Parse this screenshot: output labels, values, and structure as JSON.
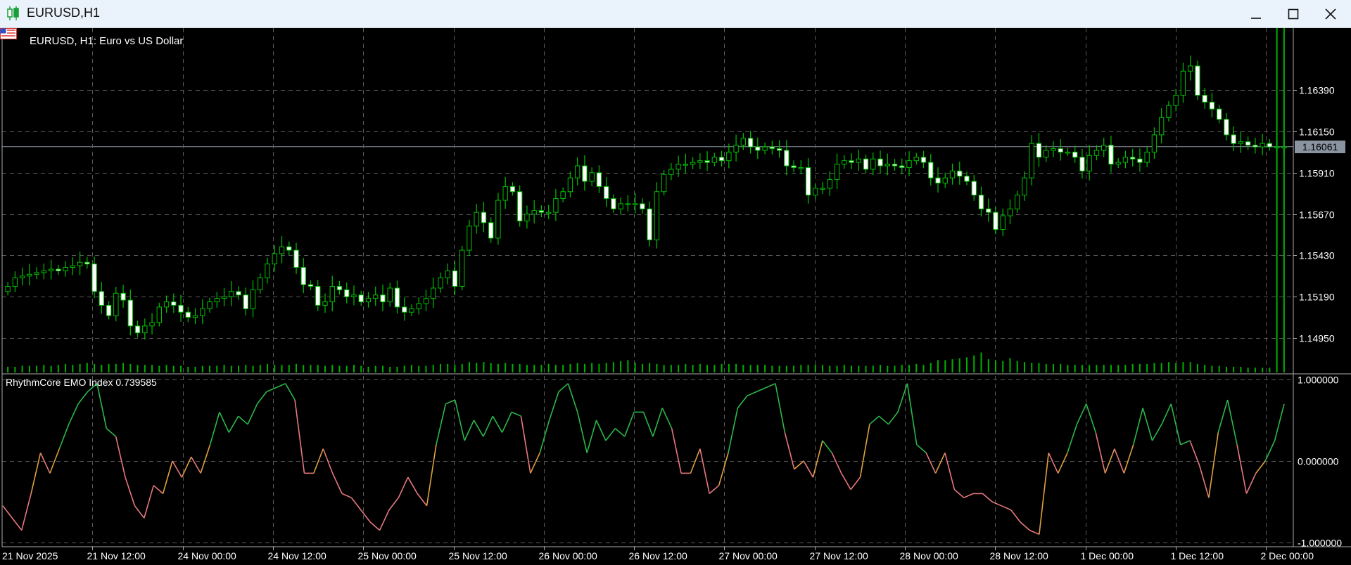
{
  "window": {
    "title": "EURUSD,H1",
    "icon": "candlestick-icon",
    "buttons": {
      "minimize": "minimize-icon",
      "maximize": "maximize-icon",
      "close": "close-icon"
    }
  },
  "chart_data": [
    {
      "type": "candlestick",
      "title": "EURUSD, H1:  Euro vs US Dollar",
      "symbol_icon": "flag-icon",
      "ylim": [
        1.1475,
        1.1675
      ],
      "y_ticks": [
        "1.16390",
        "1.16150",
        "1.15910",
        "1.15670",
        "1.15430",
        "1.15190",
        "1.14950"
      ],
      "current_price": "1.16061",
      "x_labels": [
        "21 Nov 2025",
        "21 Nov 12:00",
        "24 Nov 00:00",
        "24 Nov 12:00",
        "25 Nov 00:00",
        "25 Nov 12:00",
        "26 Nov 00:00",
        "26 Nov 12:00",
        "27 Nov 00:00",
        "27 Nov 12:00",
        "28 Nov 00:00",
        "28 Nov 12:00",
        "1 Dec 00:00",
        "1 Dec 12:00",
        "2 Dec 00:00"
      ],
      "grid": true,
      "colors": {
        "up_body": "#000000",
        "down_body": "#ffffff",
        "wick": "#00c000",
        "grid": "#5a5a5a",
        "volume": "#00b000",
        "axis_text": "#ffffff"
      },
      "closes": [
        1.1525,
        1.153,
        1.1531,
        1.1532,
        1.1533,
        1.1534,
        1.1535,
        1.1534,
        1.1536,
        1.1537,
        1.1539,
        1.1538,
        1.1522,
        1.1514,
        1.1508,
        1.1521,
        1.1517,
        1.1502,
        1.1498,
        1.1502,
        1.1504,
        1.1513,
        1.1516,
        1.1514,
        1.151,
        1.1507,
        1.1508,
        1.1512,
        1.1516,
        1.1518,
        1.1519,
        1.1522,
        1.152,
        1.1512,
        1.1523,
        1.153,
        1.1538,
        1.1544,
        1.1548,
        1.1546,
        1.1536,
        1.1526,
        1.1525,
        1.1514,
        1.1516,
        1.1525,
        1.1523,
        1.1519,
        1.152,
        1.1516,
        1.1518,
        1.152,
        1.1516,
        1.1524,
        1.1513,
        1.151,
        1.1512,
        1.1515,
        1.1518,
        1.1524,
        1.153,
        1.1534,
        1.1525,
        1.1546,
        1.156,
        1.1568,
        1.1562,
        1.1553,
        1.1575,
        1.1583,
        1.158,
        1.1563,
        1.1567,
        1.1569,
        1.1568,
        1.1568,
        1.1576,
        1.158,
        1.1588,
        1.1595,
        1.1586,
        1.1591,
        1.1583,
        1.1576,
        1.157,
        1.1573,
        1.1573,
        1.1573,
        1.157,
        1.1552,
        1.158,
        1.159,
        1.1593,
        1.1596,
        1.1596,
        1.1597,
        1.1598,
        1.1597,
        1.16,
        1.1598,
        1.1603,
        1.1607,
        1.1611,
        1.1606,
        1.1604,
        1.1606,
        1.1605,
        1.1604,
        1.1595,
        1.1594,
        1.1594,
        1.1578,
        1.1582,
        1.1582,
        1.1587,
        1.1596,
        1.1598,
        1.1597,
        1.1599,
        1.1593,
        1.1599,
        1.1595,
        1.1596,
        1.1595,
        1.1594,
        1.1598,
        1.16,
        1.1597,
        1.1588,
        1.1585,
        1.1588,
        1.1592,
        1.1589,
        1.1586,
        1.1578,
        1.157,
        1.1568,
        1.1558,
        1.1566,
        1.157,
        1.1578,
        1.1588,
        1.1608,
        1.16,
        1.1604,
        1.1605,
        1.1603,
        1.1603,
        1.16,
        1.1592,
        1.1601,
        1.1604,
        1.1607,
        1.1596,
        1.1597,
        1.16,
        1.1599,
        1.1597,
        1.1603,
        1.1613,
        1.1623,
        1.163,
        1.1636,
        1.165,
        1.1653,
        1.1636,
        1.1632,
        1.1628,
        1.1622,
        1.1613,
        1.1608,
        1.1609,
        1.1607,
        1.1606,
        1.1608,
        1.1606,
        1.1606,
        1.1606
      ],
      "volumes": [
        6,
        6,
        7,
        7,
        7,
        8,
        7,
        8,
        9,
        8,
        9,
        10,
        9,
        8,
        9,
        9,
        10,
        9,
        8,
        8,
        8,
        7,
        8,
        7,
        7,
        6,
        6,
        7,
        7,
        7,
        8,
        7,
        7,
        8,
        7,
        8,
        9,
        8,
        8,
        8,
        9,
        8,
        8,
        8,
        7,
        8,
        7,
        7,
        8,
        7,
        6,
        7,
        7,
        6,
        6,
        7,
        8,
        7,
        7,
        8,
        9,
        9,
        8,
        9,
        11,
        10,
        11,
        10,
        9,
        10,
        9,
        9,
        8,
        8,
        8,
        9,
        8,
        8,
        9,
        10,
        9,
        10,
        9,
        10,
        11,
        12,
        13,
        10,
        9,
        10,
        9,
        8,
        8,
        8,
        9,
        8,
        9,
        8,
        8,
        9,
        9,
        9,
        8,
        8,
        8,
        8,
        7,
        7,
        7,
        7,
        8,
        8,
        8,
        8,
        7,
        7,
        8,
        7,
        7,
        7,
        7,
        8,
        7,
        7,
        8,
        8,
        9,
        8,
        10,
        13,
        13,
        14,
        15,
        16,
        18,
        21,
        14,
        13,
        12,
        15,
        12,
        11,
        10,
        10,
        9,
        9,
        9,
        8,
        8,
        8,
        8,
        8,
        8,
        8,
        8,
        8,
        9,
        9,
        9,
        10,
        10,
        11,
        10,
        11,
        11,
        9,
        8,
        7,
        7,
        6,
        6,
        6,
        5,
        5,
        5,
        5
      ]
    },
    {
      "type": "line",
      "title": "RhythmCore EMO Index 0.739585",
      "ylim": [
        -1.0,
        1.0
      ],
      "y_ticks": [
        "1.000000",
        "0.000000",
        "-1.000000"
      ],
      "colors": {
        "positive": "#2bb84a",
        "negative": "#e8787e",
        "transition": "#e0a040",
        "grid": "#5a5a5a"
      },
      "values": [
        -0.55,
        -0.7,
        -0.85,
        -0.4,
        0.1,
        -0.15,
        0.15,
        0.45,
        0.7,
        0.85,
        0.95,
        0.4,
        0.3,
        -0.2,
        -0.55,
        -0.7,
        -0.3,
        -0.4,
        0.0,
        -0.2,
        0.05,
        -0.15,
        0.2,
        0.6,
        0.35,
        0.55,
        0.45,
        0.7,
        0.85,
        0.9,
        0.95,
        0.75,
        -0.15,
        -0.15,
        0.15,
        -0.15,
        -0.4,
        -0.45,
        -0.6,
        -0.75,
        -0.85,
        -0.6,
        -0.45,
        -0.2,
        -0.4,
        -0.55,
        0.2,
        0.7,
        0.75,
        0.25,
        0.5,
        0.3,
        0.55,
        0.35,
        0.6,
        0.55,
        -0.15,
        0.1,
        0.5,
        0.85,
        0.95,
        0.6,
        0.1,
        0.5,
        0.25,
        0.4,
        0.3,
        0.6,
        0.6,
        0.3,
        0.65,
        0.4,
        -0.15,
        -0.15,
        0.15,
        -0.4,
        -0.3,
        0.1,
        0.65,
        0.8,
        0.85,
        0.9,
        0.95,
        0.35,
        -0.1,
        0.0,
        -0.2,
        0.25,
        0.1,
        -0.15,
        -0.35,
        -0.2,
        0.45,
        0.55,
        0.45,
        0.6,
        0.95,
        0.2,
        0.1,
        -0.15,
        0.1,
        -0.35,
        -0.45,
        -0.4,
        -0.4,
        -0.5,
        -0.55,
        -0.6,
        -0.75,
        -0.85,
        -0.9,
        0.1,
        -0.15,
        0.1,
        0.45,
        0.7,
        0.35,
        -0.15,
        0.15,
        -0.15,
        0.2,
        0.65,
        0.25,
        0.45,
        0.7,
        0.2,
        0.25,
        -0.05,
        -0.45,
        0.35,
        0.75,
        0.2,
        -0.4,
        -0.15,
        0.0,
        0.25,
        0.7
      ]
    }
  ]
}
